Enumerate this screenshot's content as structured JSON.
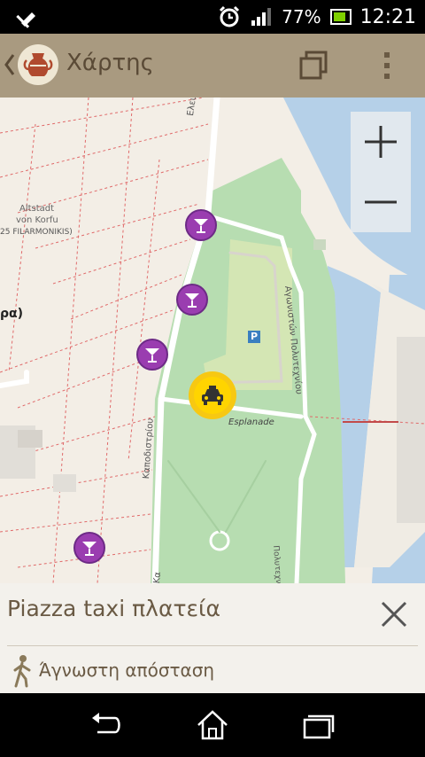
{
  "status_bar": {
    "battery_percent": "77%",
    "time": "12:21",
    "icons": [
      "notification-icon",
      "alarm-clock-icon",
      "signal-icon",
      "battery-icon"
    ]
  },
  "app_bar": {
    "title": "Χάρτης",
    "icons": [
      "back-chevron-icon",
      "app-logo-icon",
      "layers-icon",
      "overflow-menu-icon"
    ]
  },
  "map": {
    "labels": {
      "altstadt_line1": "Altstadt",
      "altstadt_line2": "von Korfu",
      "filarmonikis": "25 FILARMONIKIS)",
      "partial_place": "ρα)",
      "eleftherias": "Ελευθερίας",
      "agonistou": "Αγωνιστών Πολυτεχνίου",
      "kapodistriou": "Καποδιστρίου",
      "kapodistriou_2": "Κα",
      "esplanade": "Esplanade",
      "politechniou": "Πολυτεχνίου"
    },
    "parking_label": "P",
    "markers": [
      "bar-icon",
      "bar-icon",
      "bar-icon",
      "bar-icon",
      "taxi-icon"
    ],
    "zoom_controls": [
      "zoom-in-icon",
      "zoom-out-icon"
    ]
  },
  "bottom_sheet": {
    "place_name": "Piazza taxi πλατεία",
    "distance": "Άγνωστη απόσταση",
    "icons": [
      "close-icon",
      "walking-person-icon"
    ]
  },
  "nav_bar": {
    "icons": [
      "back-icon",
      "home-icon",
      "recent-apps-icon"
    ]
  },
  "colors": {
    "app_bar": "#a99a80",
    "map_land": "#f3eee6",
    "park": "#b7ddb1",
    "water": "#b5d0e8",
    "poi": "#9a3db0",
    "taxi": "#f7c812"
  }
}
